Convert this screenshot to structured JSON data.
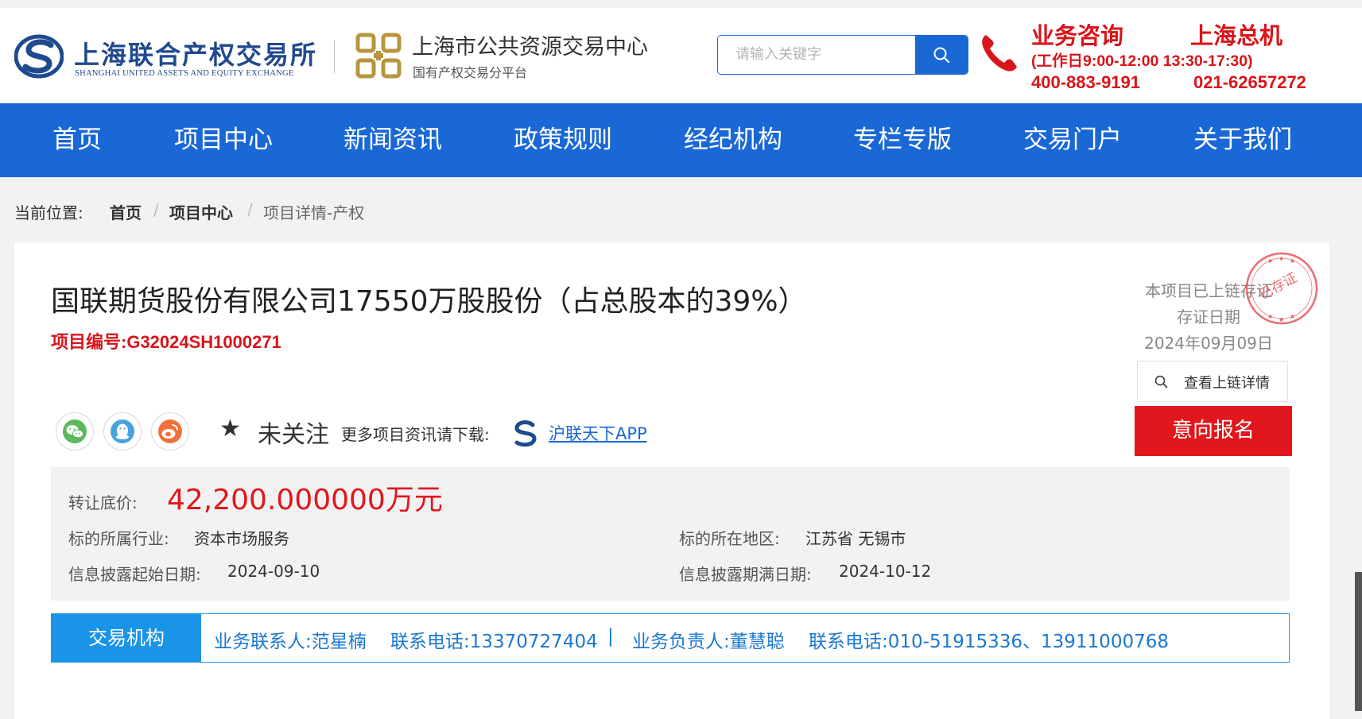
{
  "header": {
    "logo1_cn": "上海联合产权交易所",
    "logo1_en": "SHANGHAI UNITED ASSETS AND EQUITY EXCHANGE",
    "logo2_cn": "上海市公共资源交易中心",
    "logo2_sub": "国有产权交易分平台",
    "search_placeholder": "请输入关键字",
    "hotline": {
      "consult_title": "业务咨询",
      "general_title": "上海总机",
      "hours": "(工作日9:00-12:00 13:30-17:30)",
      "consult_phone": "400-883-9191",
      "general_phone": "021-62657272"
    }
  },
  "nav": [
    "首页",
    "项目中心",
    "新闻资讯",
    "政策规则",
    "经纪机构",
    "专栏专版",
    "交易门户",
    "关于我们"
  ],
  "breadcrumb": {
    "label": "当前位置:",
    "items": [
      "首页",
      "项目中心",
      "项目详情-产权"
    ],
    "separator": "/"
  },
  "project": {
    "title": "国联期货股份有限公司17550万股股份（占总股本的39%）",
    "code_label": "项目编号:",
    "code": "G32024SH1000271",
    "chain_status": "本项目已上链存证",
    "chain_date_label": "存证日期",
    "chain_date": "2024年09月09日",
    "stamp_text": "已存证",
    "chain_button": "查看上链详情",
    "signup_button": "意向报名",
    "follow_status": "未关注",
    "download_text": "更多项目资讯请下载:",
    "app_link": "沪联天下APP"
  },
  "info": {
    "price_label": "转让底价:",
    "price": "42,200.000000万元",
    "industry_label": "标的所属行业:",
    "industry": "资本市场服务",
    "region_label": "标的所在地区:",
    "region": "江苏省 无锡市",
    "start_label": "信息披露起始日期:",
    "start_date": "2024-09-10",
    "end_label": "信息披露期满日期:",
    "end_date": "2024-10-12"
  },
  "agency": {
    "tag": "交易机构",
    "contact": "业务联系人:范星楠",
    "contact_phone": "联系电话:13370727404",
    "divider": "|",
    "manager": "业务负责人:董慧聪",
    "manager_phone": "联系电话:010-51915336、13911000768"
  },
  "colors": {
    "brand_blue": "#1a68d6",
    "alert_red": "#e2161d",
    "agency_blue": "#1a94e6"
  },
  "icons": [
    "search-icon",
    "phone-icon",
    "wechat-icon",
    "qq-icon",
    "weibo-icon",
    "star-icon"
  ]
}
